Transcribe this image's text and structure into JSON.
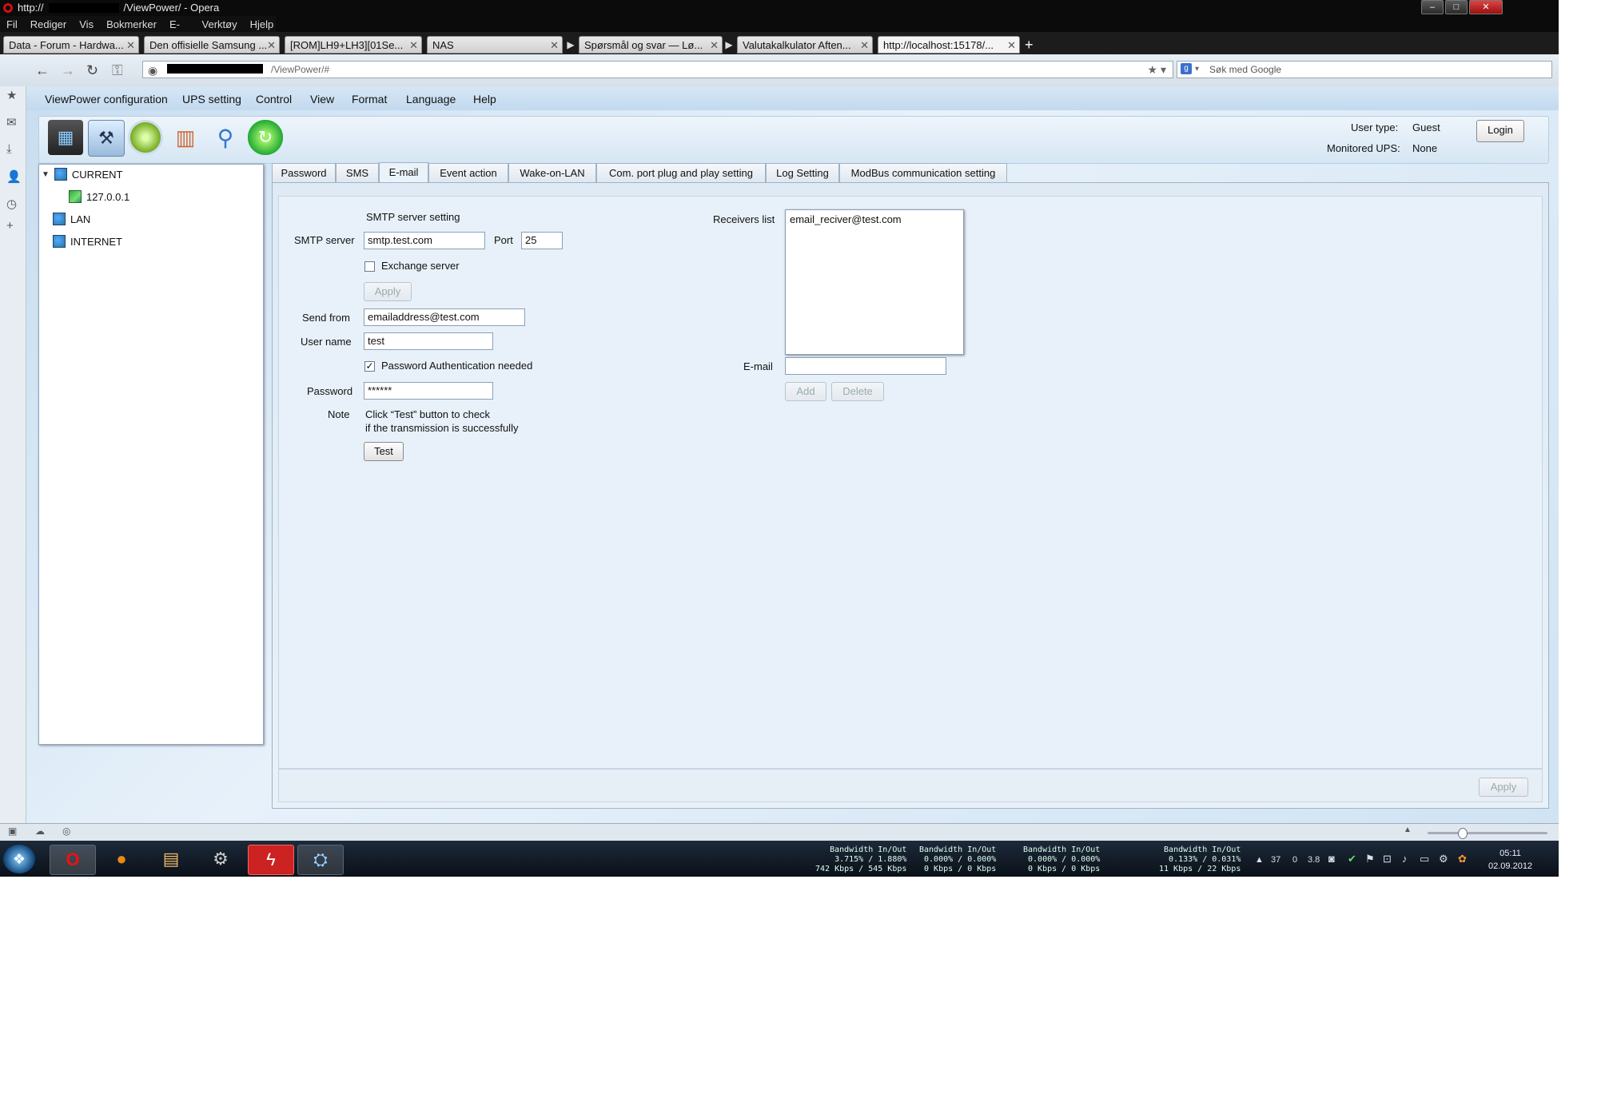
{
  "window": {
    "title_prefix": "http://",
    "title_suffix": "/ViewPower/ - Opera",
    "buttons": [
      "–",
      "□",
      "✕"
    ]
  },
  "browser_menu": [
    "Fil",
    "Rediger",
    "Vis",
    "Bokmerker",
    "E-post",
    "Verktøy",
    "Hjelp"
  ],
  "tabs": [
    {
      "label": "Data - Forum - Hardwa..."
    },
    {
      "label": "Den offisielle Samsung ..."
    },
    {
      "label": "[ROM]LH9+LH3][01Se..."
    },
    {
      "label": "NAS"
    },
    {
      "label": "Spørsmål og svar — Lø..."
    },
    {
      "label": "Valutakalkulator Aften..."
    },
    {
      "label": "http://localhost:15178/..."
    }
  ],
  "new_tab_label": "+",
  "address": {
    "url_suffix": "/ViewPower/#"
  },
  "search": {
    "placeholder": "Søk med Google"
  },
  "app_menu": [
    "ViewPower configuration",
    "UPS setting",
    "Control",
    "View",
    "Format",
    "Language",
    "Help"
  ],
  "header": {
    "user_type_label": "User type:",
    "user_type_value": "Guest",
    "monitored_label": "Monitored UPS:",
    "monitored_value": "None",
    "login_label": "Login"
  },
  "tree": {
    "current": "CURRENT",
    "localhost": "127.0.0.1",
    "lan": "LAN",
    "internet": "INTERNET"
  },
  "settings_tabs": [
    "Password",
    "SMS",
    "E-mail",
    "Event action",
    "Wake-on-LAN",
    "Com. port plug and play setting",
    "Log Setting",
    "ModBus communication setting"
  ],
  "email_form": {
    "smtp_heading": "SMTP server setting",
    "smtp_label": "SMTP server",
    "smtp_value": "smtp.test.com",
    "port_label": "Port",
    "port_value": "25",
    "exchange_label": "Exchange server",
    "exchange_checked": false,
    "apply_small": "Apply",
    "send_from_label": "Send from",
    "send_from_value": "emailaddress@test.com",
    "username_label": "User name",
    "username_value": "test",
    "auth_label": "Password Authentication needed",
    "auth_checked": true,
    "password_label": "Password",
    "password_value": "******",
    "note_label": "Note",
    "note_line1": "Click “Test” button to check",
    "note_line2": "if the transmission is successfully",
    "test_button": "Test",
    "receivers_label": "Receivers list",
    "receivers": [
      "email_reciver@test.com"
    ],
    "email_label": "E-mail",
    "email_value": "",
    "add_button": "Add",
    "delete_button": "Delete",
    "apply_bottom": "Apply"
  },
  "taskbar": {
    "bandwidth": [
      {
        "title": "Bandwidth In/Out",
        "pct": "3.715% / 1.880%",
        "rate": "742 Kbps / 545 Kbps"
      },
      {
        "title": "Bandwidth In/Out",
        "pct": "0.000% / 0.000%",
        "rate": "0 Kbps / 0 Kbps"
      },
      {
        "title": "Bandwidth In/Out",
        "pct": "0.000% / 0.000%",
        "rate": "0 Kbps / 0 Kbps"
      },
      {
        "title": "Bandwidth In/Out",
        "pct": "0.133% / 0.031%",
        "rate": "11 Kbps / 22 Kbps"
      }
    ],
    "tray_numbers": [
      "37",
      "0",
      "3.8"
    ],
    "time": "05:11",
    "date": "02.09.2012"
  }
}
